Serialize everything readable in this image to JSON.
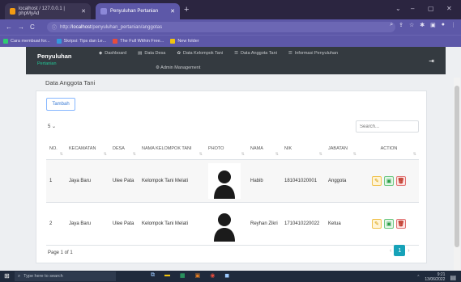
{
  "browser": {
    "tabs": [
      {
        "title": "localhost / 127.0.0.1 | phpMyAd",
        "active": false
      },
      {
        "title": "Penyuluhan Pertanian",
        "active": true
      }
    ],
    "new_tab": "+",
    "window_controls": [
      "⌄",
      "–",
      "▢",
      "✕"
    ],
    "url_prefix": "http://",
    "url_host": "localhost",
    "url_path": "/penyuluhan_pertanian/anggotas",
    "bookmarks": [
      {
        "label": "Cara membuat for...",
        "color": "#2ecc71"
      },
      {
        "label": "Skripsi: Tips dan Le...",
        "color": "#3498db"
      },
      {
        "label": "The Full Within Free...",
        "color": "#e74c3c"
      },
      {
        "label": "New folder",
        "color": "#f1c40f"
      }
    ]
  },
  "app": {
    "brand": "Penyuluhan",
    "brand_sub": "Pertanian",
    "menu": [
      "Dashboard",
      "Data Desa",
      "Data Kelompok Tani",
      "Data Anggota Tani",
      "Informasi Penyuluhan"
    ],
    "submenu": "Admin Management",
    "logout_icon": "logout-icon"
  },
  "page": {
    "title": "Data Anggota Tani",
    "add_button": "Tambah",
    "length_value": "5",
    "search_placeholder": "Search..."
  },
  "table": {
    "columns": [
      "NO.",
      "KECAMATAN",
      "DESA",
      "NAMA KELOMPOK TANI",
      "PHOTO",
      "NAMA",
      "NIK",
      "JABATAN",
      "ACTION"
    ],
    "rows": [
      {
        "no": "1",
        "kecamatan": "Jaya Baru",
        "desa": "Ulee Pata",
        "kelompok": "Kelompok Tani Melati",
        "nama": "Habib",
        "nik": "181041020001",
        "jabatan": "Anggota"
      },
      {
        "no": "2",
        "kecamatan": "Jaya Baru",
        "desa": "Ulee Pata",
        "kelompok": "Kelompok Tani Melati",
        "nama": "Reyhan Zikri",
        "nik": "1710410220022",
        "jabatan": "Ketua"
      }
    ]
  },
  "footer": {
    "page_info": "Page 1 of 1",
    "current_page": "1",
    "prev": "‹",
    "next": "›"
  },
  "taskbar": {
    "search_placeholder": "Type here to search",
    "time": "9:21",
    "date": "13/06/2022"
  }
}
